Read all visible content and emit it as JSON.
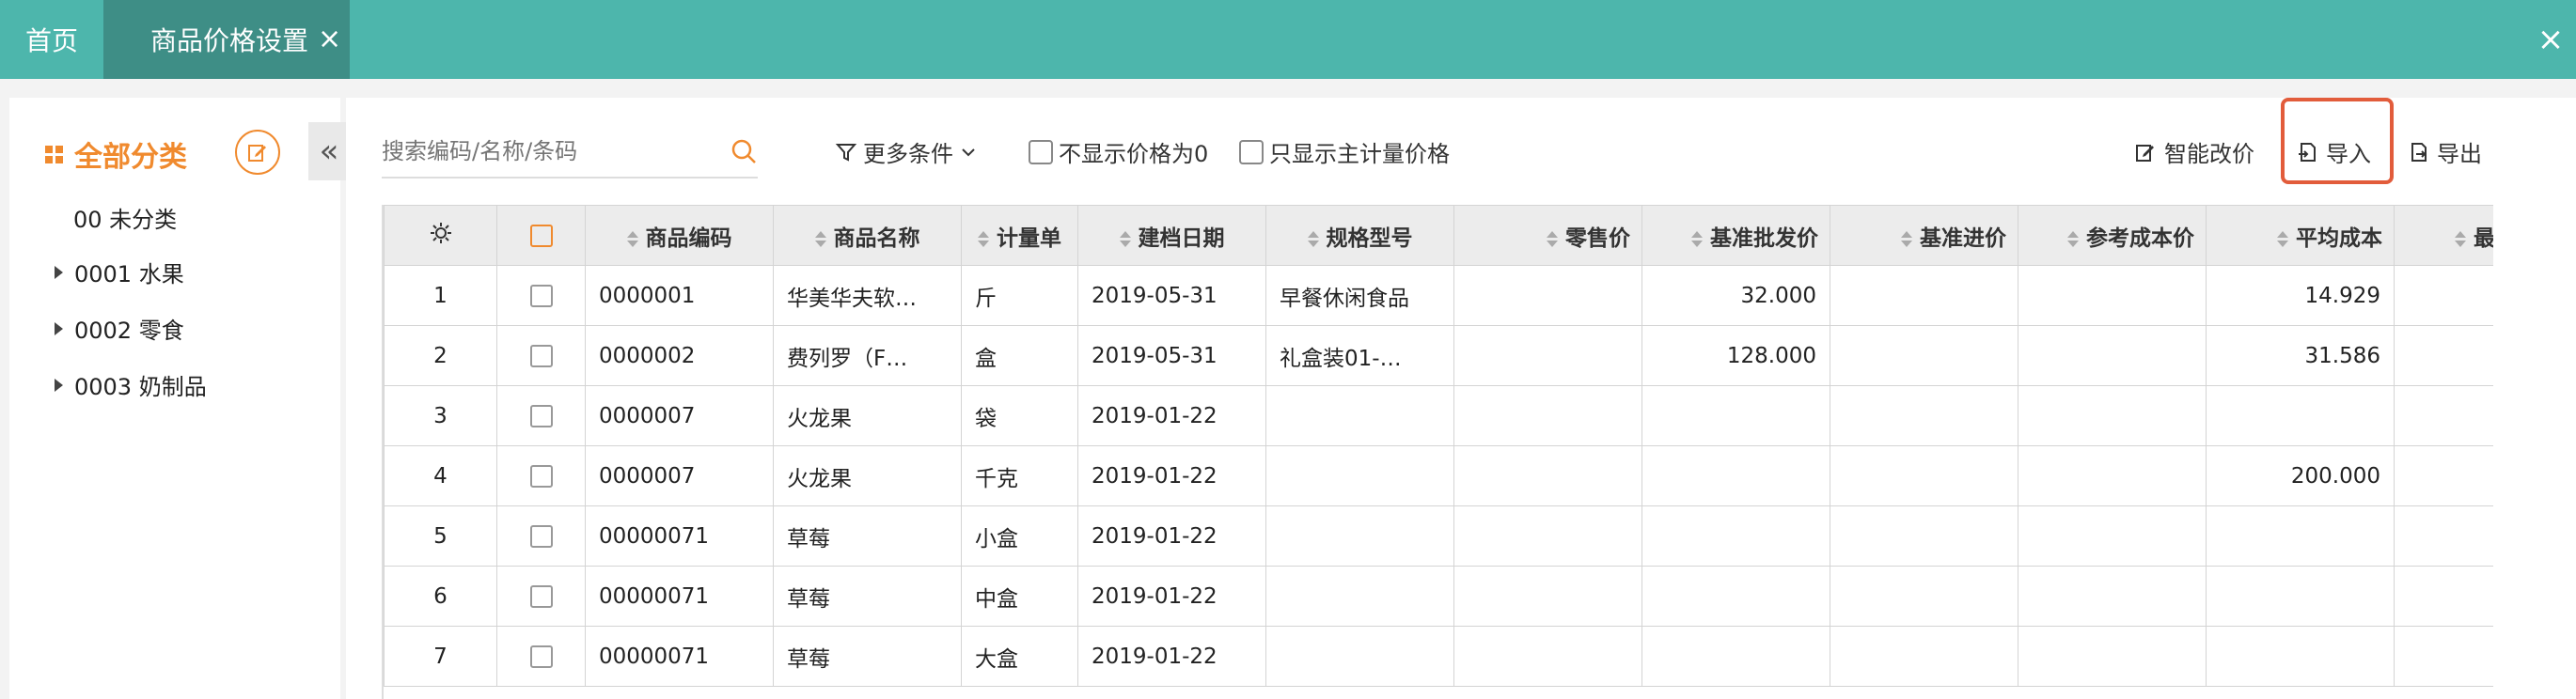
{
  "tabs": {
    "home": "首页",
    "active": "商品价格设置",
    "active_close": "×",
    "window_close": "×"
  },
  "sidebar": {
    "title": "全部分类",
    "collapse": "«",
    "items": [
      {
        "label": "00 未分类",
        "expandable": false
      },
      {
        "label": "0001 水果",
        "expandable": true
      },
      {
        "label": "0002 零食",
        "expandable": true
      },
      {
        "label": "0003 奶制品",
        "expandable": true
      }
    ]
  },
  "toolbar": {
    "search_placeholder": "搜索编码/名称/条码",
    "more_conditions": "更多条件",
    "hide_zero_price": "不显示价格为0",
    "only_main_unit": "只显示主计量价格",
    "smart_price": "智能改价",
    "import": "导入",
    "export": "导出"
  },
  "table": {
    "headers": [
      "商品编码",
      "商品名称",
      "计量单",
      "建档日期",
      "规格型号",
      "零售价",
      "基准批发价",
      "基准进价",
      "参考成本价",
      "平均成本",
      "最"
    ],
    "rows": [
      {
        "no": "1",
        "code": "0000001",
        "name": "华美华夫软…",
        "unit": "斤",
        "date": "2019-05-31",
        "spec": "早餐休闲食品",
        "retail": "",
        "wholesale": "32.000",
        "purchase": "",
        "ref_cost": "",
        "avg_cost": "14.929"
      },
      {
        "no": "2",
        "code": "0000002",
        "name": "费列罗（F…",
        "unit": "盒",
        "date": "2019-05-31",
        "spec": "礼盒装01-…",
        "retail": "",
        "wholesale": "128.000",
        "purchase": "",
        "ref_cost": "",
        "avg_cost": "31.586"
      },
      {
        "no": "3",
        "code": "0000007",
        "name": "火龙果",
        "unit": "袋",
        "date": "2019-01-22",
        "spec": "",
        "retail": "",
        "wholesale": "",
        "purchase": "",
        "ref_cost": "",
        "avg_cost": ""
      },
      {
        "no": "4",
        "code": "0000007",
        "name": "火龙果",
        "unit": "千克",
        "date": "2019-01-22",
        "spec": "",
        "retail": "",
        "wholesale": "",
        "purchase": "",
        "ref_cost": "",
        "avg_cost": "200.000"
      },
      {
        "no": "5",
        "code": "00000071",
        "name": "草莓",
        "unit": "小盒",
        "date": "2019-01-22",
        "spec": "",
        "retail": "",
        "wholesale": "",
        "purchase": "",
        "ref_cost": "",
        "avg_cost": ""
      },
      {
        "no": "6",
        "code": "00000071",
        "name": "草莓",
        "unit": "中盒",
        "date": "2019-01-22",
        "spec": "",
        "retail": "",
        "wholesale": "",
        "purchase": "",
        "ref_cost": "",
        "avg_cost": ""
      },
      {
        "no": "7",
        "code": "00000071",
        "name": "草莓",
        "unit": "大盒",
        "date": "2019-01-22",
        "spec": "",
        "retail": "",
        "wholesale": "",
        "purchase": "",
        "ref_cost": "",
        "avg_cost": ""
      }
    ]
  },
  "colors": {
    "topbar": "#4db6ac",
    "active_tab": "#3e8e86",
    "accent": "#f08a2e",
    "highlight": "#e25c3b"
  }
}
